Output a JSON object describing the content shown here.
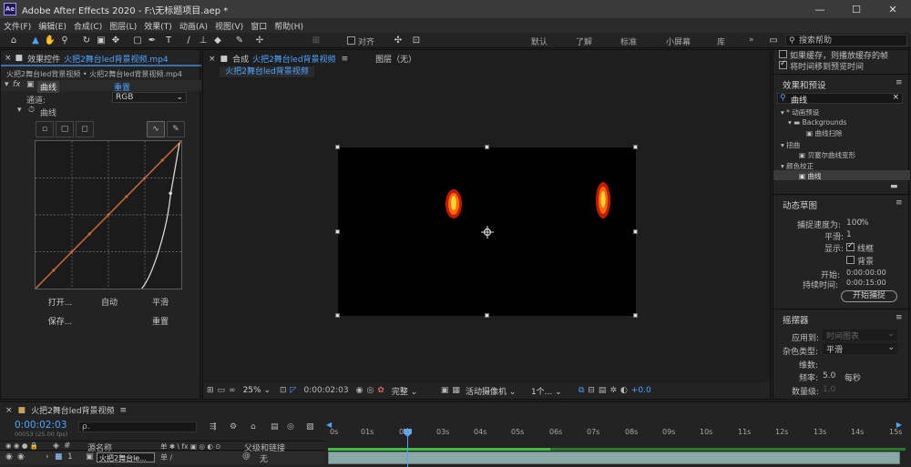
{
  "window": {
    "title": "Adobe After Effects 2020 - F:\\无标题项目.aep *",
    "icon_text": "Ae",
    "minimize": "—",
    "maximize": "☐",
    "close": "✕"
  },
  "menu": [
    "文件(F)",
    "编辑(E)",
    "合成(C)",
    "图层(L)",
    "效果(T)",
    "动画(A)",
    "视图(V)",
    "窗口",
    "帮助(H)"
  ],
  "toolbar": {
    "align_label": "对齐",
    "workspaces": [
      "默认",
      "了解",
      "标准",
      "小屏幕",
      "库"
    ],
    "more": "»",
    "search_placeholder": "搜索帮助"
  },
  "effect_controls": {
    "tab_label": "效果控件",
    "tab_file": "火把2舞台led背景视频.mp4",
    "breadcrumb": "火把2舞台led背景视频 • 火把2舞台led背景视频.mp4",
    "fx": "fx",
    "effect_name": "曲线",
    "reset": "重置",
    "channel_label": "通道:",
    "channel_value": "RGB",
    "curves_label": "曲线",
    "open_btn": "打开...",
    "auto_btn": "自动",
    "smooth_btn": "平滑",
    "save_btn": "保存...",
    "reset_btn": "重置"
  },
  "composition": {
    "tab_prefix": "合成",
    "tab_name": "火把2舞台led背景视频",
    "sub_tab": "火把2舞台led背景视频",
    "layer_tab": "图层（无）",
    "zoom": "25%",
    "timecode": "0:00:02:03",
    "resolution": "完整",
    "camera": "活动摄像机",
    "views": "1个...",
    "exposure": "+0.0"
  },
  "right_top": {
    "cache_opt1": "如果缓存，则播放缓存的帧",
    "cache_opt2": "将时间移到预览时间"
  },
  "effects_presets": {
    "title": "效果和预设",
    "search_value": "曲线",
    "items": [
      {
        "label": "* 动画预设"
      },
      {
        "label": "Backgrounds"
      },
      {
        "label": "曲线扫除"
      },
      {
        "label": "扭曲"
      },
      {
        "label": "贝塞尔曲线变形"
      },
      {
        "label": "颜色校正"
      },
      {
        "label": "曲线"
      }
    ]
  },
  "motion_sketch": {
    "title": "动态草图",
    "capture_speed_label": "捕捉速度为:",
    "capture_speed_value": "100",
    "capture_speed_unit": "%",
    "smoothing_label": "平滑:",
    "smoothing_value": "1",
    "show_label": "显示:",
    "wireframe": "线框",
    "background": "背景",
    "start_label": "开始:",
    "start_value": "0:00:00:00",
    "duration_label": "持续时间:",
    "duration_value": "0:00:15:00",
    "capture_btn": "开始捕捉"
  },
  "wiggler": {
    "title": "摇摆器",
    "apply_label": "应用到:",
    "apply_value": "时间图表",
    "noise_label": "杂色类型:",
    "noise_value": "平滑",
    "dim_label": "维数:",
    "freq_label": "频率:",
    "freq_value": "5.0",
    "freq_unit": "每秒",
    "magnitude_label": "数量级:",
    "magnitude_value": "1.0"
  },
  "timeline": {
    "tab_name": "火把2舞台led背景视频",
    "timecode": "0:00:02:03",
    "frames": "00053 (25.00 fps)",
    "search_placeholder": "ρ.",
    "col_source": "源名称",
    "col_switches": "单 ✱ \\ fx ▣ ◎ ◐ ⊙",
    "col_parent": "父级和链接",
    "layer_index": "1",
    "layer_name": "火把2舞台le...",
    "parent_value": "无",
    "ticks": [
      "0s",
      "01s",
      "02s",
      "03s",
      "04s",
      "05s",
      "06s",
      "07s",
      "08s",
      "09s",
      "10s",
      "11s",
      "12s",
      "13s",
      "14s",
      "15s"
    ]
  },
  "colors": {
    "accent": "#4ea3ff",
    "curve_line": "#c0683a",
    "panel_bg": "#232323"
  }
}
